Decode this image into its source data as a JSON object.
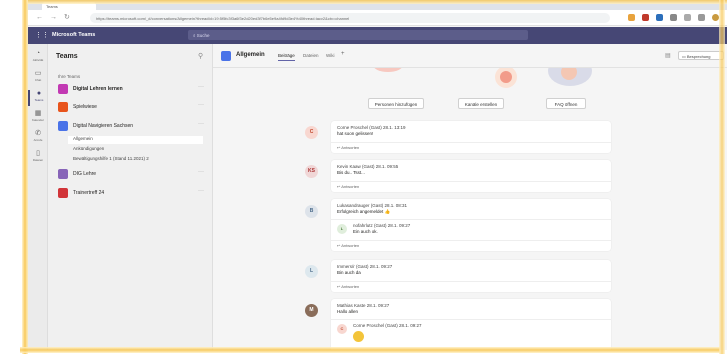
{
  "browser": {
    "tab_title": "Teams",
    "url": "https://teams.microsoft.com/_#/conversations/Allgemein?threadId=19:5f5fc3f3a6f3e2d20ed3f7b6e5e9a4fd9d3e4%40thread.tacv2&ctx=channel",
    "accent": "#dfe3ea"
  },
  "teams_header": {
    "app_title": "Microsoft Teams",
    "search_placeholder": "Suche",
    "bar_color": "#464775"
  },
  "rail": {
    "items": [
      {
        "label": "Aktivität",
        "icon": "bell-icon"
      },
      {
        "label": "Chat",
        "icon": "chat-icon"
      },
      {
        "label": "Teams",
        "icon": "teams-icon"
      },
      {
        "label": "Kalender",
        "icon": "calendar-icon"
      },
      {
        "label": "Anrufe",
        "icon": "phone-icon"
      },
      {
        "label": "Dateien",
        "icon": "file-icon"
      }
    ]
  },
  "teams_panel": {
    "heading": "Teams",
    "section_label": "Ihre Teams",
    "teams": [
      {
        "name": "Digital Lehren lernen",
        "color": "#c239b3"
      },
      {
        "name": "Spielwiese",
        "color": "#e8541c"
      },
      {
        "name": "Digital Navigieren Sachsen",
        "color": "#4a73e8"
      },
      {
        "name": "DIG Lehre",
        "color": "#8764b8"
      },
      {
        "name": "Trainertreff 24",
        "color": "#d13438"
      }
    ],
    "channels": [
      "Allgemein",
      "Ankündigungen",
      "Bewältigungshilfe 1 (Stand 11.2021)  2"
    ]
  },
  "channel": {
    "name": "Allgemein",
    "tabs": [
      "Beiträge",
      "Dateien",
      "Wiki"
    ],
    "add_tab": "+",
    "meet_label": "Besprechung",
    "actions": [
      "Personen hinzufügen",
      "Kanäle erstellen",
      "FAQ öffnen"
    ]
  },
  "messages": [
    {
      "initials": "C",
      "author": "Corne Proschel (Gast)  28.1. 13:19",
      "text": "hat soon gelissen!",
      "reply": "↩ Antworten",
      "avatar_color": "#f8d7d0",
      "text_color": "#c0472d"
    },
    {
      "initials": "KS",
      "author": "Kevin Kaaw (Gast)  28.1. 09:55",
      "text": "Bis du.. Tsst...",
      "reply": "↩ Antworten",
      "avatar_color": "#f0d6d6",
      "text_color": "#a33"
    },
    {
      "initials": "B",
      "author": "Lukasandrauger (Gast)  28.1. 08:31",
      "text": "Erfolgreich angemeldet 👍",
      "reply": "↩ Antworten",
      "avatar_color": "#dde3ea",
      "text_color": "#4a6a8a",
      "inner": {
        "initials": "L",
        "author": "nofahrlutz (Gast)  28.1. 09:27",
        "text": "Ein auch ok."
      }
    },
    {
      "initials": "L",
      "author": "Immers/r (Gast)  28.1. 09:27",
      "text": "Bin auch da",
      "reply": "↩ Antworten",
      "avatar_color": "#dde8ee",
      "text_color": "#4a6a8a"
    },
    {
      "initials": "M",
      "author": "Mathias Kaste  28.1. 09:27",
      "text": "Hallo allen",
      "reply": "",
      "avatar_color": "#8a6d5a",
      "text_color": "#fff",
      "inner": {
        "initials": "C",
        "author": "Corne Proschel (Gast)  28.1. 09:27",
        "text": ""
      }
    }
  ]
}
